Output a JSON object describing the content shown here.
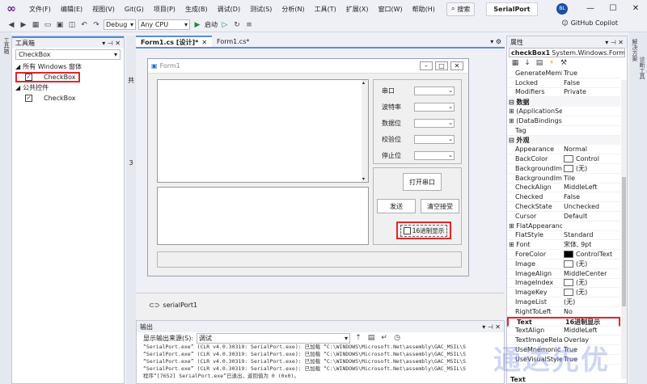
{
  "menubar": {
    "items": [
      "文件(F)",
      "编辑(E)",
      "视图(V)",
      "Git(G)",
      "项目(P)",
      "生成(B)",
      "调试(D)",
      "测试(S)",
      "分析(N)",
      "工具(T)",
      "扩展(X)",
      "窗口(W)",
      "帮助(H)"
    ],
    "search_label": "搜索",
    "project_name": "SerialPort",
    "avatar": "BL",
    "min": "—",
    "max": "☐",
    "close": "✕"
  },
  "toolbar": {
    "config": "Debug",
    "platform": "Any CPU",
    "start_label": "启动",
    "copilot_label": "GitHub Copilot"
  },
  "left_strip": {
    "label": "工具箱"
  },
  "toolbox": {
    "title": "工具箱",
    "search_value": "CheckBox",
    "group1": "所有 Windows 窗体",
    "group1_item": "CheckBox",
    "group2": "公共控件",
    "group2_item": "CheckBox"
  },
  "side_marks": {
    "a": "共",
    "b": "3"
  },
  "tabs": [
    {
      "label": "Form1.cs [设计]*",
      "close": "✕"
    },
    {
      "label": "Form1.cs*",
      "close": ""
    }
  ],
  "form": {
    "title": "Form1",
    "labels": [
      "串口",
      "波特率",
      "数据位",
      "校验位",
      "停止位"
    ],
    "open_button": "打开串口",
    "send_button": "发送",
    "clear_button": "清空接受",
    "hex_checkbox": "16进制显示"
  },
  "tray": {
    "component": "serialPort1"
  },
  "output": {
    "title": "输出",
    "source_label": "显示输出来源(S):",
    "source_value": "调试",
    "lines": [
      "“SerialPort.exe” (CLR v4.0.30319: SerialPort.exe): 已加载 “C:\\WINDOWS\\Microsoft.Net\\assembly\\GAC_MSIL\\S",
      "“SerialPort.exe” (CLR v4.0.30319: SerialPort.exe): 已加载 “C:\\WINDOWS\\Microsoft.Net\\assembly\\GAC_MSIL\\S",
      "“SerialPort.exe” (CLR v4.0.30319: SerialPort.exe): 已加载 “C:\\WINDOWS\\Microsoft.Net\\assembly\\GAC_MSIL\\S",
      "“SerialPort.exe” (CLR v4.0.30319: SerialPort.exe): 已加载 “C:\\WINDOWS\\Microsoft.Net\\assembly\\GAC_MSIL\\S",
      "程序“[7652] SerialPort.exe”已退出，返回值为 0 (0x0)。"
    ]
  },
  "properties": {
    "title": "属性",
    "object_name": "checkBox1",
    "object_type": "System.Windows.Forms.",
    "rows_top": [
      {
        "name": "GenerateMembe",
        "value": "True"
      },
      {
        "name": "Locked",
        "value": "False"
      },
      {
        "name": "Modifiers",
        "value": "Private"
      }
    ],
    "cat_data": "数据",
    "rows_data": [
      {
        "name": "(ApplicationSetti",
        "value": ""
      },
      {
        "name": "(DataBindings)",
        "value": ""
      },
      {
        "name": "Tag",
        "value": ""
      }
    ],
    "cat_appearance": "外观",
    "rows_appearance": [
      {
        "name": "Appearance",
        "value": "Normal"
      },
      {
        "name": "BackColor",
        "value": "Control"
      },
      {
        "name": "BackgroundImag",
        "value": "(无)"
      },
      {
        "name": "BackgroundImag",
        "value": "Tile"
      },
      {
        "name": "CheckAlign",
        "value": "MiddleLeft"
      },
      {
        "name": "Checked",
        "value": "False"
      },
      {
        "name": "CheckState",
        "value": "Unchecked"
      },
      {
        "name": "Cursor",
        "value": "Default"
      },
      {
        "name": "FlatAppearance",
        "value": ""
      },
      {
        "name": "FlatStyle",
        "value": "Standard"
      },
      {
        "name": "Font",
        "value": "宋体, 9pt"
      },
      {
        "name": "ForeColor",
        "value": "ControlText"
      },
      {
        "name": "Image",
        "value": "(无)"
      },
      {
        "name": "ImageAlign",
        "value": "MiddleCenter"
      },
      {
        "name": "ImageIndex",
        "value": "(无)"
      },
      {
        "name": "ImageKey",
        "value": "(无)"
      },
      {
        "name": "ImageList",
        "value": "(无)"
      },
      {
        "name": "RightToLeft",
        "value": "No"
      },
      {
        "name": "Text",
        "value": "16进制显示"
      },
      {
        "name": "TextAlign",
        "value": "MiddleLeft"
      },
      {
        "name": "TextImageRelati",
        "value": "Overlay"
      },
      {
        "name": "UseMnemonic",
        "value": "True"
      },
      {
        "name": "UseVisualStyleBa",
        "value": "True"
      }
    ],
    "footer": "Text"
  },
  "right_strip": {
    "a": "解决方案",
    "b": "诊断工具"
  },
  "watermark": "通达先优",
  "colors": {
    "accent": "#4c8edc",
    "highlight": "#e3242b",
    "vs_purple": "#68217a"
  }
}
